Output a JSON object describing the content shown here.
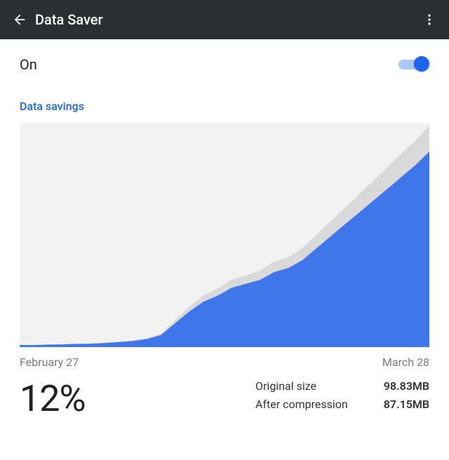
{
  "appbar": {
    "title": "Data Saver"
  },
  "toggle": {
    "label": "On",
    "state": true
  },
  "section_label": "Data savings",
  "dates": {
    "start": "February 27",
    "end": "March 28"
  },
  "percent": "12%",
  "sizes": {
    "original_label": "Original size",
    "original_value": "98.83MB",
    "compressed_label": "After compression",
    "compressed_value": "87.15MB"
  },
  "chart_data": {
    "type": "area",
    "title": "",
    "xlabel": "",
    "ylabel": "",
    "x_range": [
      "February 27",
      "March 28"
    ],
    "ylim": [
      0,
      100
    ],
    "series": [
      {
        "name": "Original size (cumulative MB)",
        "values": [
          1,
          1,
          1.2,
          1.3,
          1.5,
          1.7,
          2,
          2.5,
          3,
          4,
          6,
          12,
          18,
          23,
          26,
          30,
          32,
          34,
          38,
          40,
          44,
          50,
          56,
          62,
          68,
          74,
          80,
          86,
          92,
          98.83
        ]
      },
      {
        "name": "After compression (cumulative MB)",
        "values": [
          0.9,
          0.9,
          1.1,
          1.2,
          1.4,
          1.5,
          1.8,
          2.2,
          2.7,
          3.6,
          5.4,
          10.6,
          15.8,
          20.2,
          22.9,
          26.4,
          28.2,
          29.9,
          33.4,
          35.2,
          38.7,
          44,
          49.3,
          54.6,
          59.8,
          65.1,
          70.4,
          75.7,
          81,
          87.15
        ]
      }
    ],
    "colors": {
      "original": "#d9d9d9",
      "compressed": "#3f76ea",
      "background": "#f2f2f2"
    }
  }
}
